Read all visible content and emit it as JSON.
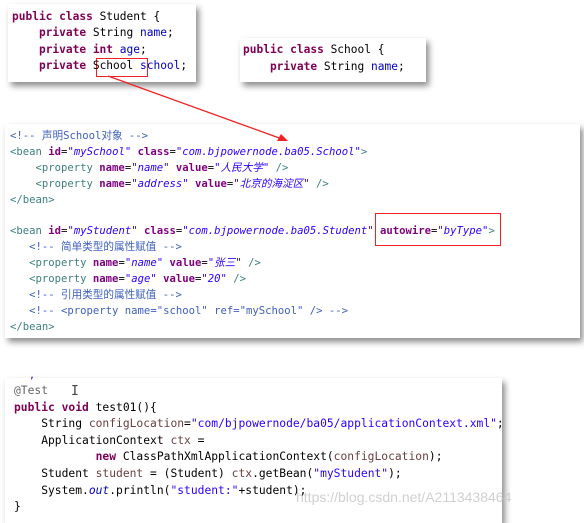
{
  "colors": {
    "keyword": "#7f0055",
    "field": "#0000c0",
    "string": "#2a00ff",
    "xml_tag": "#3f7f7f",
    "xml_attr": "#7f007f",
    "comment": "#3f5fbf",
    "highlight": "#e22222"
  },
  "student_class": [
    [
      [
        "public class ",
        "kw"
      ],
      [
        "Student {",
        "pl"
      ]
    ],
    [
      [
        "    private ",
        "kw"
      ],
      [
        "String ",
        "pl"
      ],
      [
        "name",
        "fld"
      ],
      [
        ";",
        "pl"
      ]
    ],
    [
      [
        "    private int ",
        "kw"
      ],
      [
        "age",
        "fld"
      ],
      [
        ";",
        "pl"
      ]
    ],
    [
      [
        "    private ",
        "kw"
      ],
      [
        "School",
        "pl"
      ],
      [
        " school",
        "fld"
      ],
      [
        ";",
        "pl"
      ]
    ]
  ],
  "school_class": [
    [
      [
        "public class ",
        "kw"
      ],
      [
        "School {",
        "pl"
      ]
    ],
    [
      [
        "    private ",
        "kw"
      ],
      [
        "String ",
        "pl"
      ],
      [
        "name",
        "fld"
      ],
      [
        ";",
        "pl"
      ]
    ]
  ],
  "xml_config": [
    [
      [
        "<!-- 声明School对象 -->",
        "cmt"
      ]
    ],
    [
      [
        "<bean ",
        "tag"
      ],
      [
        "id",
        "attr"
      ],
      [
        "=",
        "pl"
      ],
      [
        "\"mySchool\" ",
        "istr"
      ],
      [
        "class",
        "attr"
      ],
      [
        "=",
        "pl"
      ],
      [
        "\"com.bjpowernode.ba05.School\"",
        "istr"
      ],
      [
        ">",
        "tag"
      ]
    ],
    [
      [
        "    <property ",
        "tag"
      ],
      [
        "name",
        "attr"
      ],
      [
        "=",
        "pl"
      ],
      [
        "\"name\" ",
        "istr"
      ],
      [
        "value",
        "attr"
      ],
      [
        "=",
        "pl"
      ],
      [
        "\"人民大学\" ",
        "istr"
      ],
      [
        "/>",
        "tag"
      ]
    ],
    [
      [
        "    <property ",
        "tag"
      ],
      [
        "name",
        "attr"
      ],
      [
        "=",
        "pl"
      ],
      [
        "\"address\" ",
        "istr"
      ],
      [
        "value",
        "attr"
      ],
      [
        "=",
        "pl"
      ],
      [
        "\"北京的海淀区\" ",
        "istr"
      ],
      [
        "/>",
        "tag"
      ]
    ],
    [
      [
        "</bean>",
        "tag"
      ]
    ],
    [],
    [
      [
        "<bean ",
        "tag"
      ],
      [
        "id",
        "attr"
      ],
      [
        "=",
        "pl"
      ],
      [
        "\"myStudent\" ",
        "istr"
      ],
      [
        "class",
        "attr"
      ],
      [
        "=",
        "pl"
      ],
      [
        "\"com.bjpowernode.ba05.Student\" ",
        "istr"
      ],
      [
        "autowire",
        "attr"
      ],
      [
        "=",
        "pl"
      ],
      [
        "\"byType\"",
        "istr"
      ],
      [
        ">",
        "tag"
      ]
    ],
    [
      [
        "   <!-- 简单类型的属性赋值 -->",
        "cmt"
      ]
    ],
    [
      [
        "   <property ",
        "tag"
      ],
      [
        "name",
        "attr"
      ],
      [
        "=",
        "pl"
      ],
      [
        "\"name\" ",
        "istr"
      ],
      [
        "value",
        "attr"
      ],
      [
        "=",
        "pl"
      ],
      [
        "\"张三\" ",
        "istr"
      ],
      [
        "/>",
        "tag"
      ]
    ],
    [
      [
        "   <property ",
        "tag"
      ],
      [
        "name",
        "attr"
      ],
      [
        "=",
        "pl"
      ],
      [
        "\"age\" ",
        "istr"
      ],
      [
        "value",
        "attr"
      ],
      [
        "=",
        "pl"
      ],
      [
        "\"20\" ",
        "istr"
      ],
      [
        "/>",
        "tag"
      ]
    ],
    [
      [
        "   <!-- 引用类型的属性赋值 -->",
        "cmt"
      ]
    ],
    [
      [
        "   <!-- <property name=\"school\" ref=\"mySchool\" /> -->",
        "cmt"
      ]
    ],
    [
      [
        "</bean>",
        "tag"
      ]
    ]
  ],
  "test_code": [
    [
      [
        "@Test",
        "ann"
      ]
    ],
    [
      [
        "public void ",
        "kw"
      ],
      [
        "test01(){",
        "pl"
      ]
    ],
    [
      [
        "    String ",
        "pl"
      ],
      [
        "configLocation",
        "loc"
      ],
      [
        "=",
        "pl"
      ],
      [
        "\"com/bjpowernode/ba05/applicationContext.xml\"",
        "str"
      ],
      [
        ";",
        "pl"
      ]
    ],
    [
      [
        "    ApplicationContext ",
        "pl"
      ],
      [
        "ctx",
        "loc"
      ],
      [
        " =",
        "pl"
      ]
    ],
    [
      [
        "            new ",
        "kw"
      ],
      [
        "ClassPathXmlApplicationContext(",
        "pl"
      ],
      [
        "configLocation",
        "loc"
      ],
      [
        ");",
        "pl"
      ]
    ],
    [
      [
        "    Student ",
        "pl"
      ],
      [
        "student",
        "loc"
      ],
      [
        " = (Student) ",
        "pl"
      ],
      [
        "ctx",
        "loc"
      ],
      [
        ".getBean(",
        "pl"
      ],
      [
        "\"myStudent\"",
        "str"
      ],
      [
        ");",
        "pl"
      ]
    ],
    [
      [
        "    System.",
        "pl"
      ],
      [
        "out",
        "sout"
      ],
      [
        ".println(",
        "pl"
      ],
      [
        "\"student:\"",
        "str"
      ],
      [
        "+student);",
        "pl"
      ]
    ],
    [
      [
        "}",
        "pl"
      ]
    ]
  ],
  "watermark": "https://blog.csdn.net/A2113438464"
}
